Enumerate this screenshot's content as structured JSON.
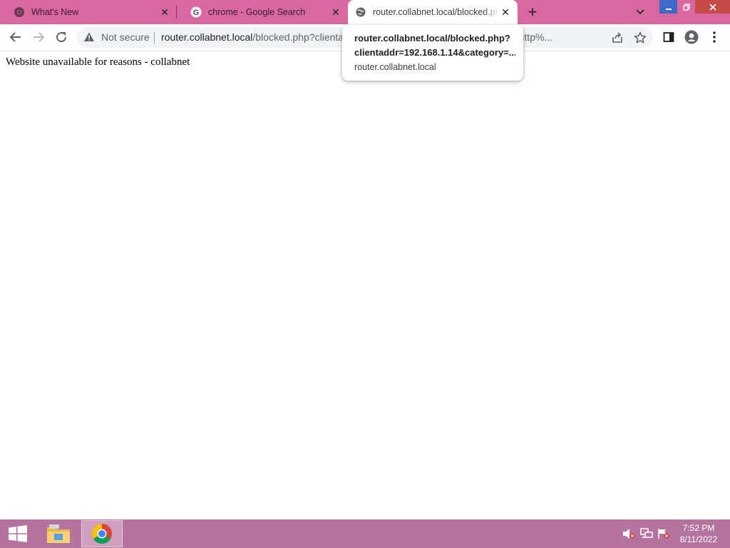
{
  "browser": {
    "tabs": [
      {
        "title": "What's New",
        "icon": "chrome-icon",
        "active": false
      },
      {
        "title": "chrome - Google Search",
        "icon": "google-g-icon",
        "active": false
      },
      {
        "title": "router.collabnet.local/blocked.php?clientaddr=192.168.1.14",
        "icon": "globe-icon",
        "active": true
      }
    ],
    "new_tab_label": "+"
  },
  "toolbar": {
    "security_label": "Not secure",
    "url_host": "router.collabnet.local",
    "url_path": "/blocked.php?clientaddr=192.168.1.14&category=temp&url=http%..."
  },
  "page": {
    "body_text": "Website unavailable for reasons - collabnet"
  },
  "hover_card": {
    "title_line1": "router.collabnet.local/blocked.php?",
    "title_line2": "clientaddr=192.168.1.14&category=...",
    "domain": "router.collabnet.local"
  },
  "taskbar": {
    "apps": [
      "file-explorer-icon",
      "chrome-icon"
    ],
    "tray_icons": [
      "speaker-muted-icon",
      "network-icon",
      "action-center-icon"
    ],
    "time": "7:52 PM",
    "date": "8/11/2022"
  },
  "colors": {
    "tabstrip": "#d8689f",
    "taskbar": "#b4749d",
    "close_button": "#c64a4a",
    "minimize_button": "#3c6ac6"
  }
}
